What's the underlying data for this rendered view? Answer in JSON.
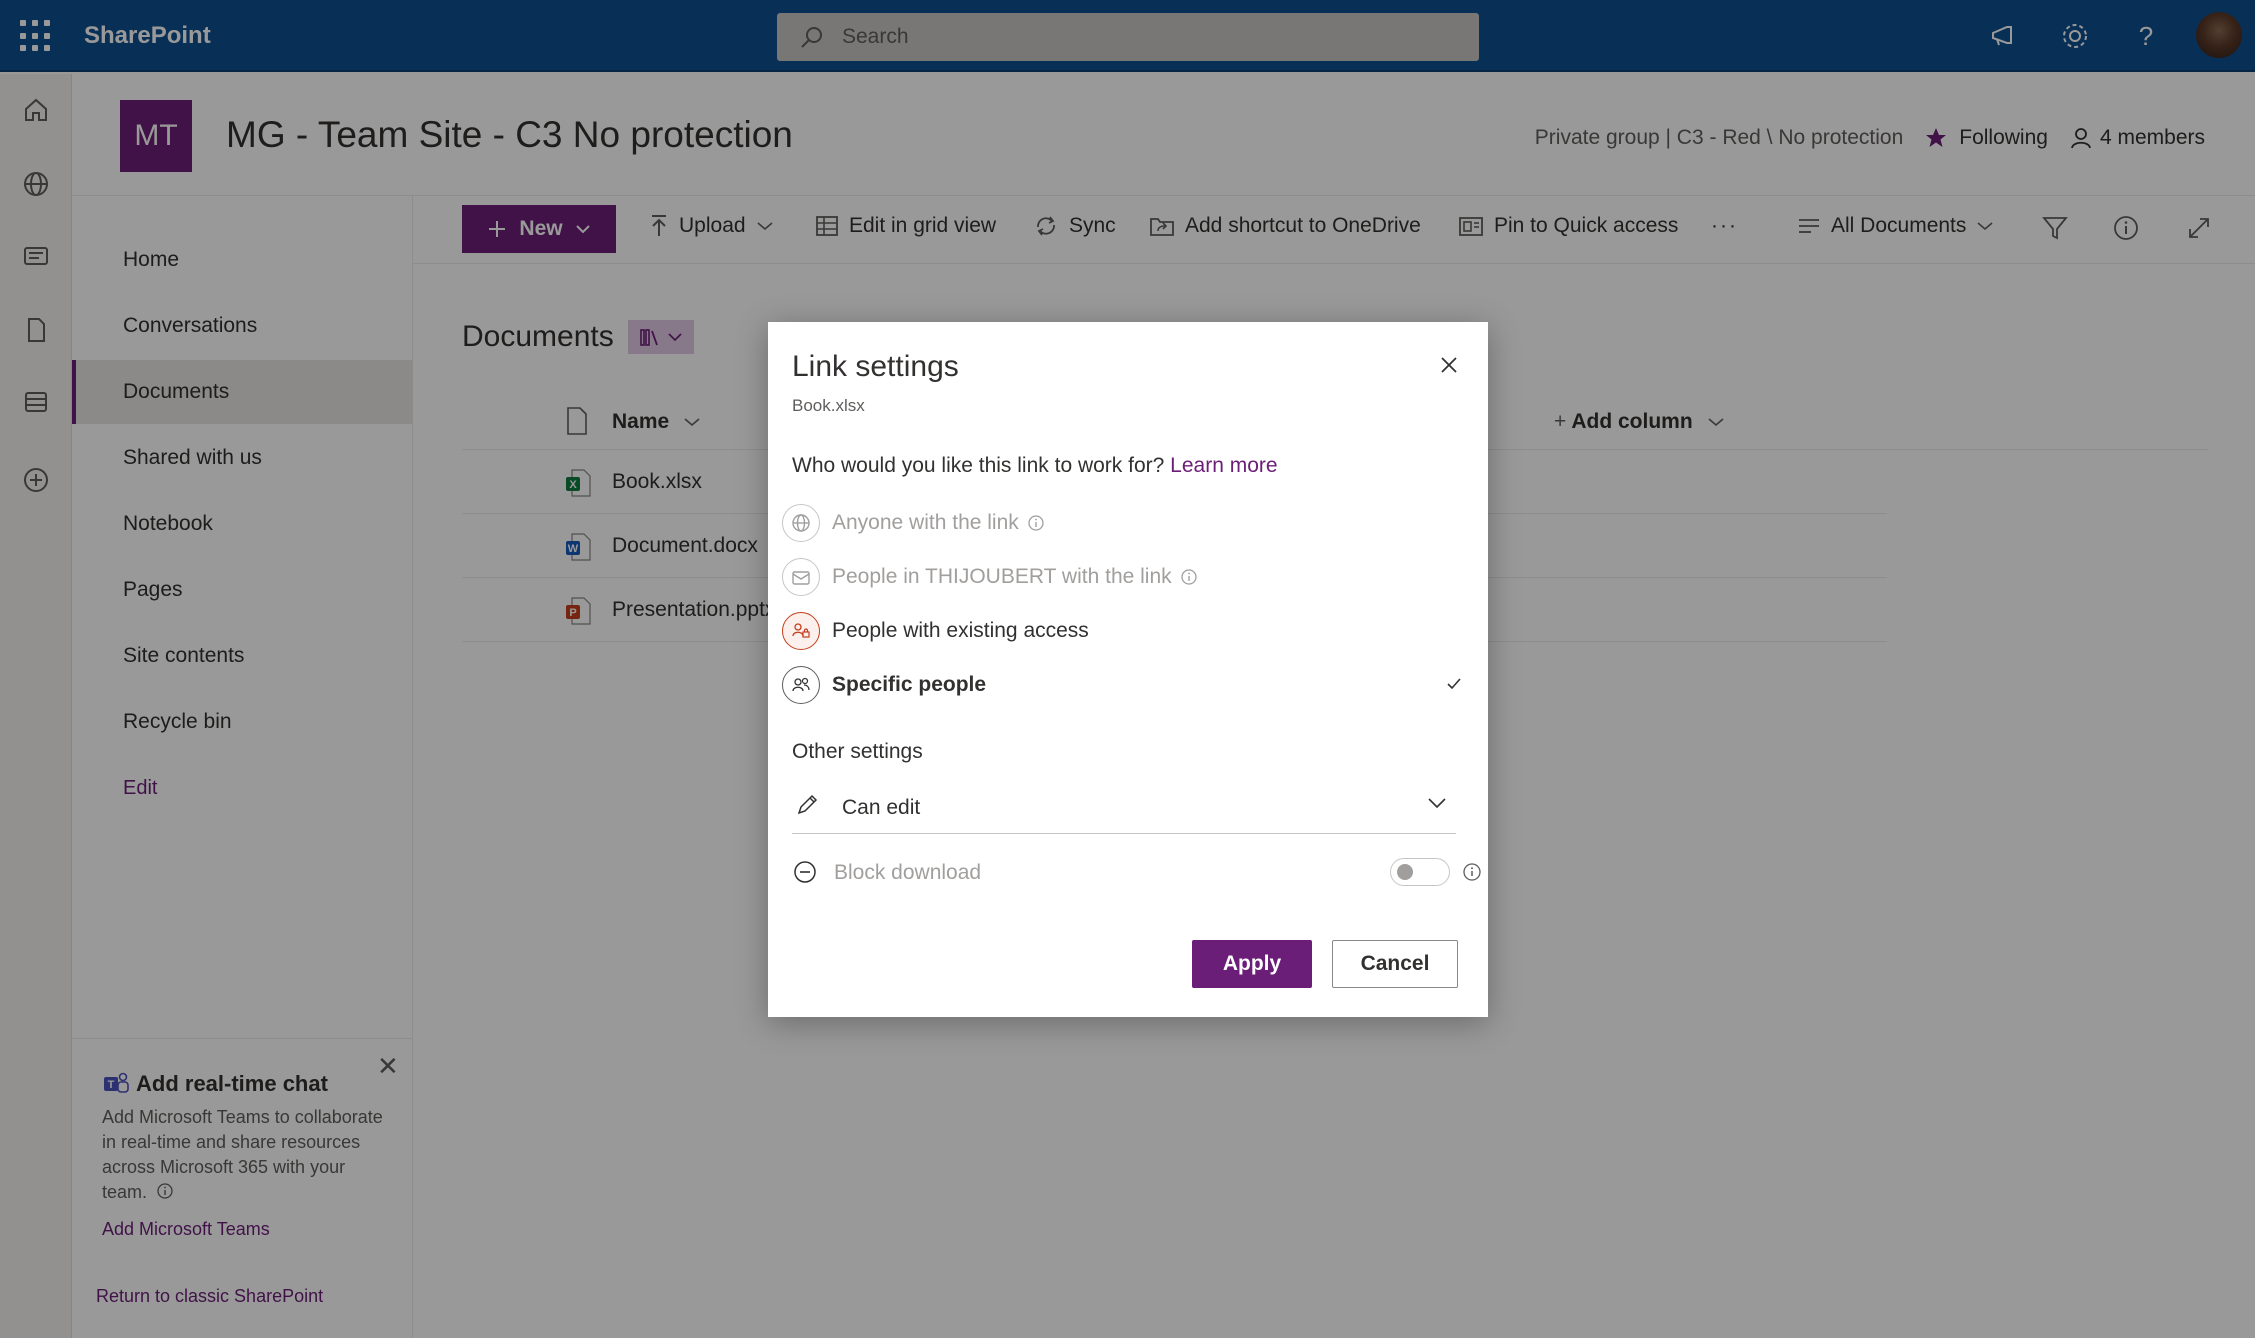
{
  "suite": {
    "app_name": "SharePoint",
    "search_placeholder": "Search"
  },
  "site": {
    "logo_initials": "MT",
    "title": "MG - Team Site - C3 No protection",
    "classification": "Private group | C3 - Red \\ No protection",
    "following_label": "Following",
    "members_label": "4 members"
  },
  "nav": {
    "items": [
      {
        "label": "Home"
      },
      {
        "label": "Conversations"
      },
      {
        "label": "Documents"
      },
      {
        "label": "Shared with us"
      },
      {
        "label": "Notebook"
      },
      {
        "label": "Pages"
      },
      {
        "label": "Site contents"
      },
      {
        "label": "Recycle bin"
      }
    ],
    "edit_label": "Edit",
    "chat_card": {
      "title": "Add real-time chat",
      "description": "Add Microsoft Teams to collaborate in real-time and share resources across Microsoft 365 with your team.",
      "link": "Add Microsoft Teams"
    },
    "return_link": "Return to classic SharePoint"
  },
  "commands": {
    "new": "New",
    "upload": "Upload",
    "edit_grid": "Edit in grid view",
    "sync": "Sync",
    "add_shortcut": "Add shortcut to OneDrive",
    "pin": "Pin to Quick access",
    "more": "···",
    "view": "All Documents"
  },
  "library": {
    "title": "Documents",
    "columns": {
      "name": "Name",
      "add_column": "Add column"
    },
    "files": [
      {
        "name": "Book.xlsx",
        "type": "excel"
      },
      {
        "name": "Document.docx",
        "type": "word"
      },
      {
        "name": "Presentation.pptx",
        "type": "powerpoint"
      }
    ]
  },
  "dialog": {
    "title": "Link settings",
    "file": "Book.xlsx",
    "question": "Who would you like this link to work for?",
    "learn_more": "Learn more",
    "options": [
      {
        "label": "Anyone with the link",
        "state": "disabled"
      },
      {
        "label": "People in THIJOUBERT with the link",
        "state": "disabled"
      },
      {
        "label": "People with existing access",
        "state": "enabled"
      },
      {
        "label": "Specific people",
        "state": "selected"
      }
    ],
    "other_settings": "Other settings",
    "permission": "Can edit",
    "block_download": "Block download",
    "block_download_on": false,
    "apply": "Apply",
    "cancel": "Cancel"
  },
  "colors": {
    "suite_bar": "#0e4f8f",
    "accent": "#6b1e77"
  }
}
